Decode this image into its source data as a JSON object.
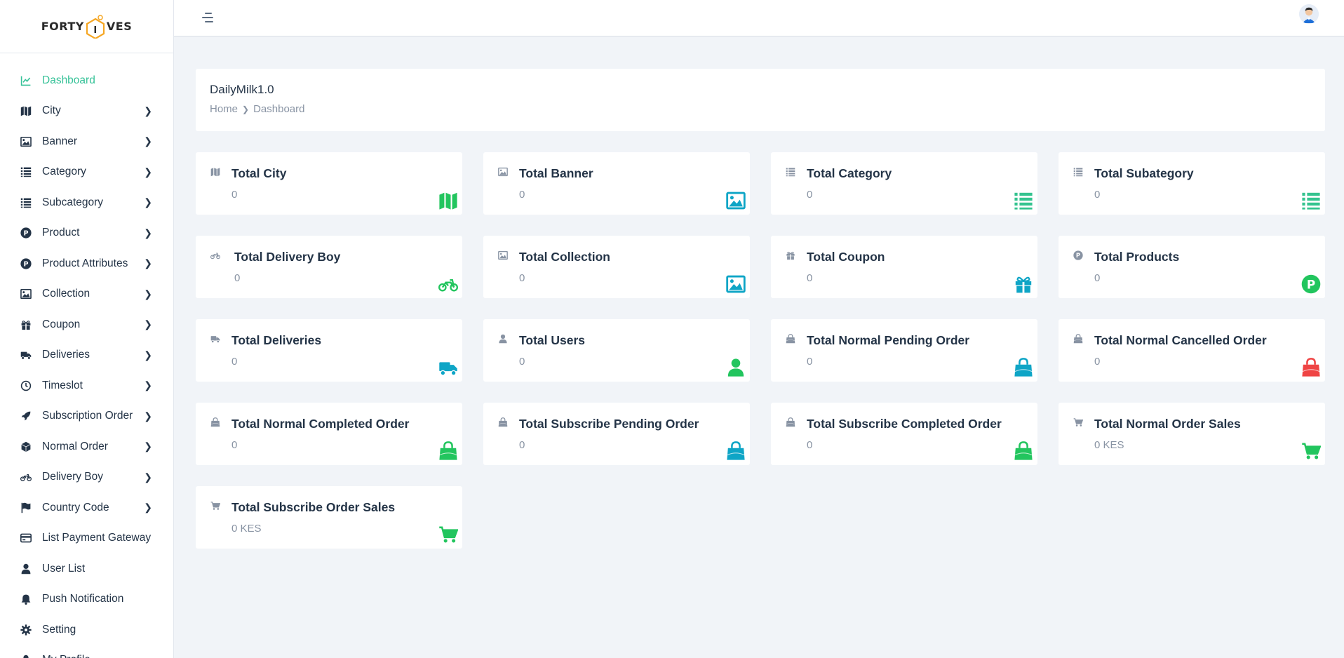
{
  "brand": {
    "left": "FORTY",
    "hex_letter": "I",
    "right": "VES"
  },
  "sidebar": {
    "items": [
      {
        "label": "Dashboard",
        "icon": "chart-line-icon",
        "has_chevron": false,
        "active": true
      },
      {
        "label": "City",
        "icon": "map-icon",
        "has_chevron": true
      },
      {
        "label": "Banner",
        "icon": "image-icon",
        "has_chevron": true
      },
      {
        "label": "Category",
        "icon": "list-icon",
        "has_chevron": true
      },
      {
        "label": "Subcategory",
        "icon": "list-icon",
        "has_chevron": true
      },
      {
        "label": "Product",
        "icon": "product-p-icon",
        "has_chevron": true
      },
      {
        "label": "Product Attributes",
        "icon": "product-p-icon",
        "has_chevron": true
      },
      {
        "label": "Collection",
        "icon": "image-icon",
        "has_chevron": true
      },
      {
        "label": "Coupon",
        "icon": "gift-icon",
        "has_chevron": true
      },
      {
        "label": "Deliveries",
        "icon": "truck-icon",
        "has_chevron": true
      },
      {
        "label": "Timeslot",
        "icon": "clock-icon",
        "has_chevron": true
      },
      {
        "label": "Subscription Order",
        "icon": "rocket-icon",
        "has_chevron": true
      },
      {
        "label": "Normal Order",
        "icon": "cube-icon",
        "has_chevron": true
      },
      {
        "label": "Delivery Boy",
        "icon": "motorcycle-icon",
        "has_chevron": true
      },
      {
        "label": "Country Code",
        "icon": "flag-icon",
        "has_chevron": true
      },
      {
        "label": "List Payment Gateway",
        "icon": "credit-card-icon",
        "has_chevron": false
      },
      {
        "label": "User List",
        "icon": "user-icon",
        "has_chevron": false
      },
      {
        "label": "Push Notification",
        "icon": "bell-icon",
        "has_chevron": false
      },
      {
        "label": "Setting",
        "icon": "gear-icon",
        "has_chevron": false
      },
      {
        "label": "My Profile",
        "icon": "user-icon",
        "has_chevron": false
      }
    ]
  },
  "header": {
    "title": "DailyMilk1.0",
    "breadcrumb": {
      "home": "Home",
      "current": "Dashboard"
    }
  },
  "cards": [
    {
      "title": "Total City",
      "value": "0",
      "small_icon": "map-icon",
      "big_icon": "map-icon",
      "color": "#22c55e"
    },
    {
      "title": "Total Banner",
      "value": "0",
      "small_icon": "image-icon",
      "big_icon": "image-icon",
      "color": "#0ea5c6"
    },
    {
      "title": "Total Category",
      "value": "0",
      "small_icon": "list-icon",
      "big_icon": "list-icon",
      "color": "#34c38f"
    },
    {
      "title": "Total Subategory",
      "value": "0",
      "small_icon": "list-icon",
      "big_icon": "list-icon",
      "color": "#34c38f"
    },
    {
      "title": "Total Delivery Boy",
      "value": "0",
      "small_icon": "motorcycle-icon",
      "big_icon": "motorcycle-icon",
      "color": "#22c55e"
    },
    {
      "title": "Total Collection",
      "value": "0",
      "small_icon": "image-icon",
      "big_icon": "image-icon",
      "color": "#0ea5c6"
    },
    {
      "title": "Total Coupon",
      "value": "0",
      "small_icon": "gift-icon",
      "big_icon": "gift-icon",
      "color": "#0ea5c6"
    },
    {
      "title": "Total Products",
      "value": "0",
      "small_icon": "product-p-icon",
      "big_icon": "product-p-icon",
      "color": "#22c55e"
    },
    {
      "title": "Total Deliveries",
      "value": "0",
      "small_icon": "truck-icon",
      "big_icon": "truck-icon",
      "color": "#0ea5c6"
    },
    {
      "title": "Total Users",
      "value": "0",
      "small_icon": "user-icon",
      "big_icon": "user-icon",
      "color": "#22c55e"
    },
    {
      "title": "Total Normal Pending Order",
      "value": "0",
      "small_icon": "shopping-bag-icon",
      "big_icon": "shopping-bag-icon",
      "color": "#0ea5c6"
    },
    {
      "title": "Total Normal Cancelled Order",
      "value": "0",
      "small_icon": "shopping-bag-icon",
      "big_icon": "shopping-bag-icon",
      "color": "#ef4444"
    },
    {
      "title": "Total Normal Completed Order",
      "value": "0",
      "small_icon": "shopping-bag-icon",
      "big_icon": "shopping-bag-icon",
      "color": "#22c55e"
    },
    {
      "title": "Total Subscribe Pending Order",
      "value": "0",
      "small_icon": "shopping-bag-icon",
      "big_icon": "shopping-bag-icon",
      "color": "#0ea5c6"
    },
    {
      "title": "Total Subscribe Completed Order",
      "value": "0",
      "small_icon": "shopping-bag-icon",
      "big_icon": "shopping-bag-icon",
      "color": "#22c55e"
    },
    {
      "title": "Total Normal Order Sales",
      "value": "0 KES",
      "small_icon": "shopping-cart-icon",
      "big_icon": "shopping-cart-icon",
      "color": "#22c55e"
    },
    {
      "title": "Total Subscribe Order Sales",
      "value": "0 KES",
      "small_icon": "shopping-cart-icon",
      "big_icon": "shopping-cart-icon",
      "color": "#22c55e"
    }
  ],
  "colors": {
    "active": "#36c298",
    "small_icon": "#8893a3"
  }
}
